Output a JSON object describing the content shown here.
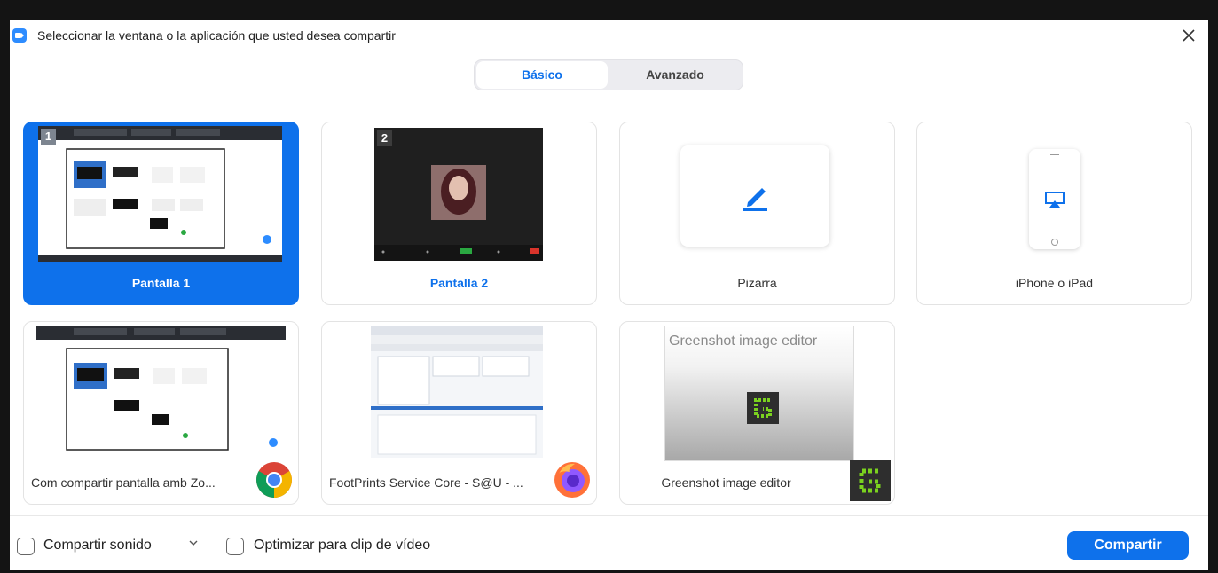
{
  "window": {
    "title": "Seleccionar la ventana o la aplicación que usted desea compartir"
  },
  "tabs": [
    {
      "label": "Básico",
      "active": true
    },
    {
      "label": "Avanzado",
      "active": false
    }
  ],
  "cards": [
    {
      "label": "Pantalla 1",
      "badge": "1",
      "selected": true
    },
    {
      "label": "Pantalla 2",
      "badge": "2",
      "selected": false
    },
    {
      "label": "Pizarra",
      "selected": false
    },
    {
      "label": "iPhone o iPad",
      "selected": false
    },
    {
      "label": "Com compartir pantalla amb Zo...",
      "app_icon": "chrome-icon",
      "selected": false
    },
    {
      "label": "FootPrints Service Core - S@U - ...",
      "app_icon": "firefox-icon",
      "selected": false
    },
    {
      "label": "Greenshot image editor",
      "thumb_title": "Greenshot image editor",
      "app_icon": "greenshot-icon",
      "selected": false
    }
  ],
  "options": {
    "share_sound": "Compartir sonido",
    "optimize_video": "Optimizar para clip de vídeo"
  },
  "share_button": "Compartir",
  "colors": {
    "accent": "#0e71eb",
    "greenshot": "#7bd21f"
  }
}
